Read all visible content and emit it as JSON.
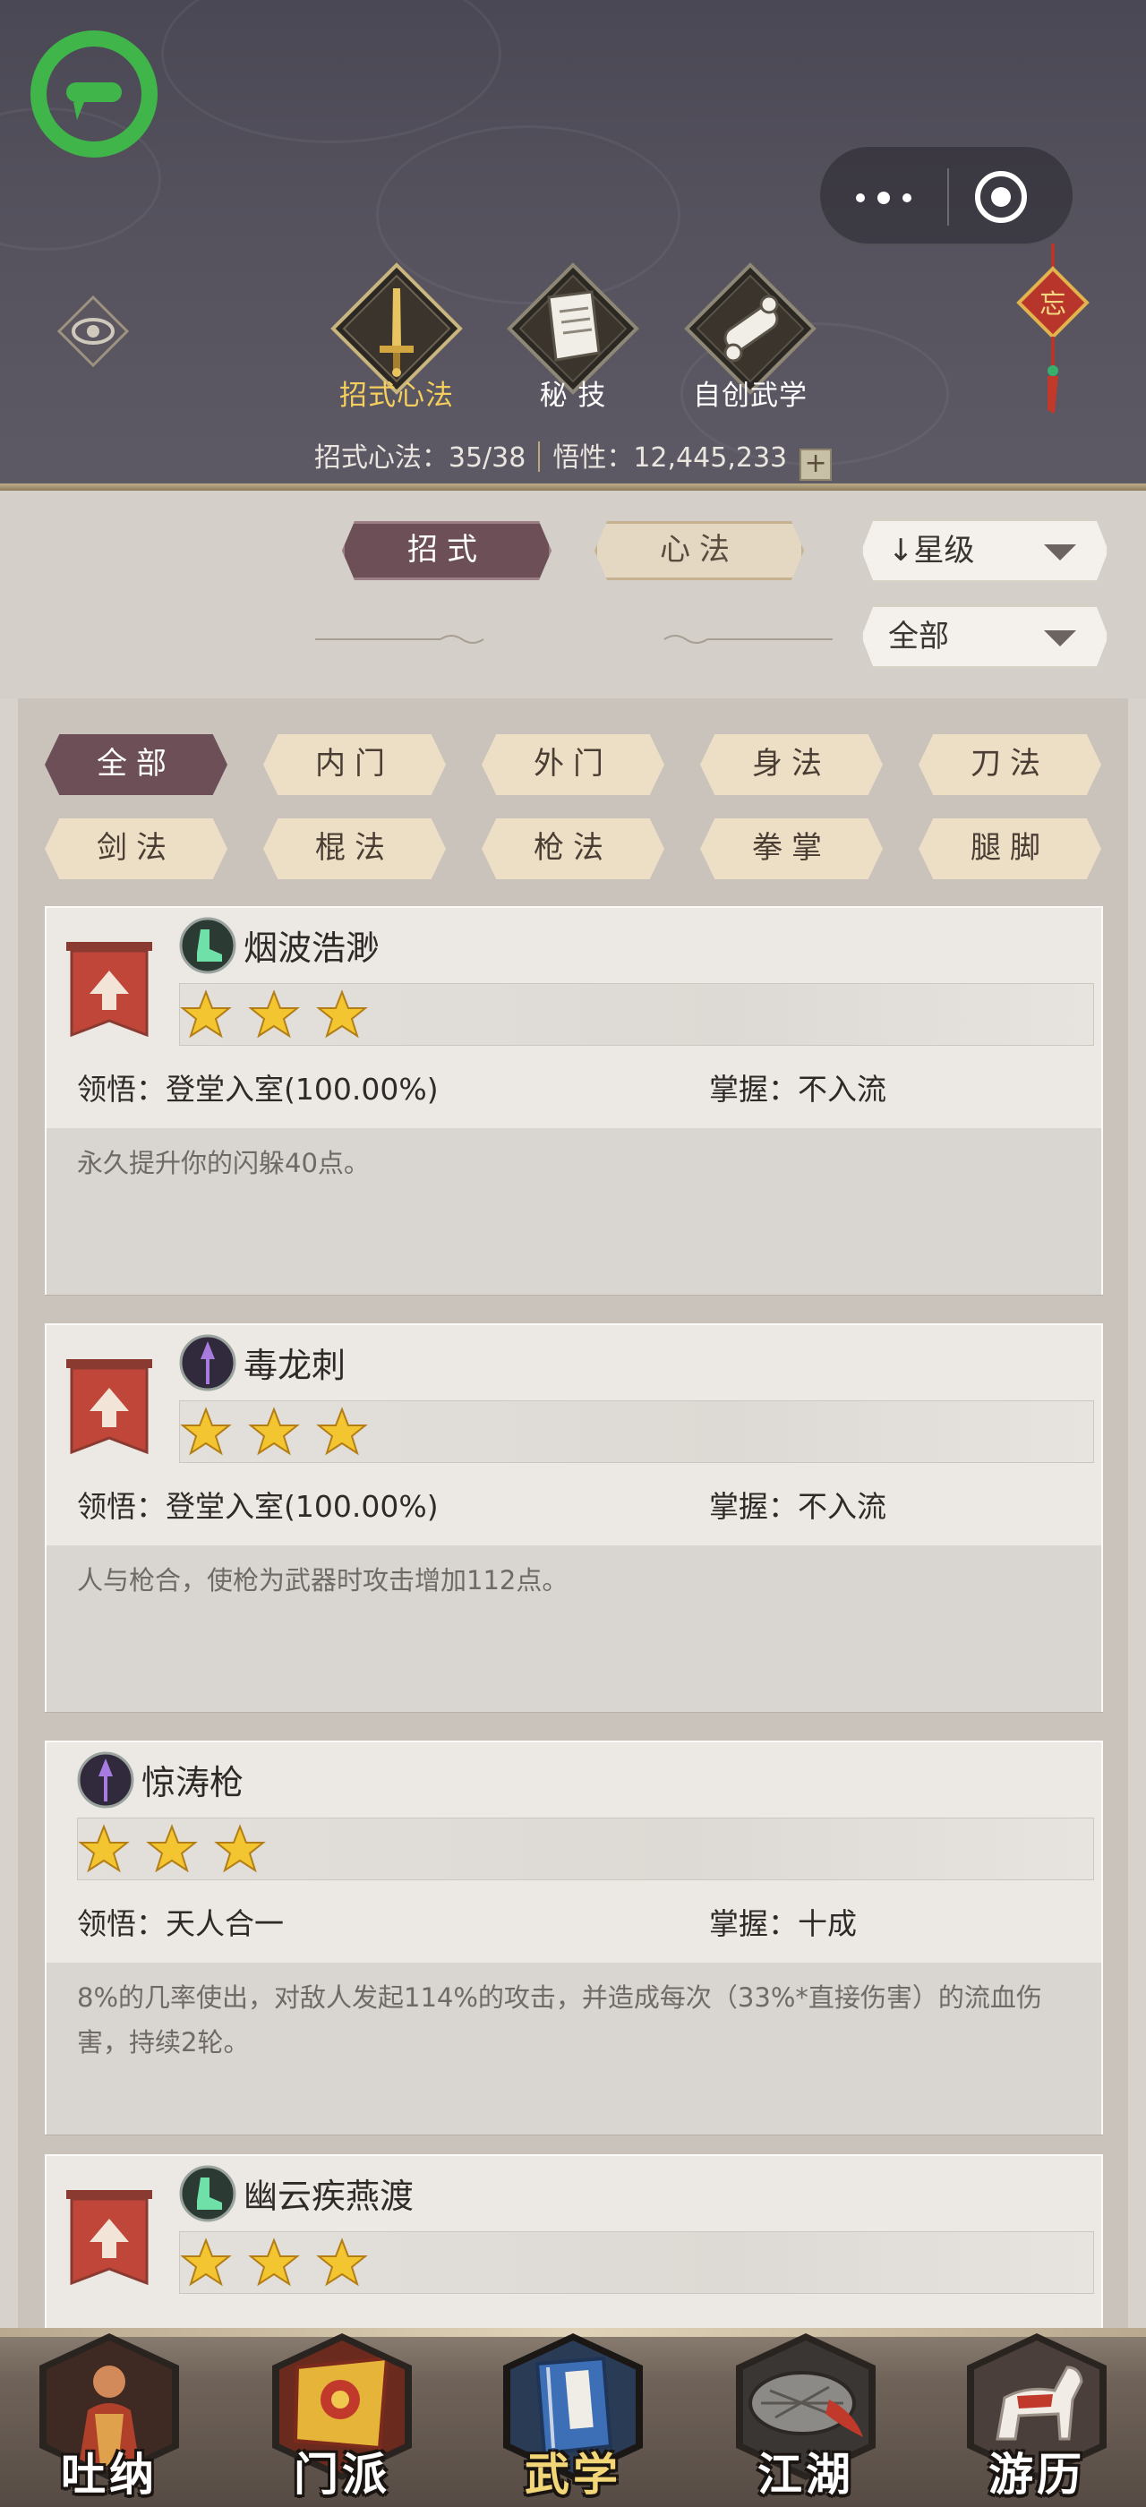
{
  "top_tabs": [
    {
      "label": "招式心法",
      "icon": "sword-icon"
    },
    {
      "label": "秘 技",
      "icon": "book-icon"
    },
    {
      "label": "自创武学",
      "icon": "scroll-icon"
    }
  ],
  "stats": {
    "moves_label": "招式心法：",
    "moves_value": "35/38",
    "insight_label": "悟性：",
    "insight_value": "12,445,233",
    "plus": "+"
  },
  "charm_char": "忘",
  "mode_tabs": [
    {
      "label": "招式",
      "active": true
    },
    {
      "label": "心法",
      "active": false
    }
  ],
  "sort_dropdown": {
    "arrow": "↓",
    "value": "星级"
  },
  "filter_dropdown": {
    "value": "全部"
  },
  "categories": [
    {
      "label": "全部",
      "active": true
    },
    {
      "label": "内门",
      "active": false
    },
    {
      "label": "外门",
      "active": false
    },
    {
      "label": "身法",
      "active": false
    },
    {
      "label": "刀法",
      "active": false
    },
    {
      "label": "剑法",
      "active": false
    },
    {
      "label": "棍法",
      "active": false
    },
    {
      "label": "枪法",
      "active": false
    },
    {
      "label": "拳掌",
      "active": false
    },
    {
      "label": "腿脚",
      "active": false
    }
  ],
  "skills": [
    {
      "name": "烟波浩渺",
      "type_icon": "boot-icon",
      "stars": 3,
      "upgradable": true,
      "lingwu_label": "领悟：",
      "lingwu": "登堂入室(100.00%)",
      "zhangwo_label": "掌握：",
      "zhangwo": "不入流",
      "desc": "永久提升你的闪躲40点。"
    },
    {
      "name": "毒龙刺",
      "type_icon": "spear-icon",
      "stars": 3,
      "upgradable": true,
      "lingwu_label": "领悟：",
      "lingwu": "登堂入室(100.00%)",
      "zhangwo_label": "掌握：",
      "zhangwo": "不入流",
      "desc": "人与枪合，使枪为武器时攻击增加112点。"
    },
    {
      "name": "惊涛枪",
      "type_icon": "spear-icon",
      "stars": 3,
      "upgradable": false,
      "lingwu_label": "领悟：",
      "lingwu": "天人合一",
      "zhangwo_label": "掌握：",
      "zhangwo": "十成",
      "desc": "8%的几率使出，对敌人发起114%的攻击，并造成每次（33%*直接伤害）的流血伤害，持续2轮。"
    },
    {
      "name": "幽云疾燕渡",
      "type_icon": "boot-icon",
      "stars": 3,
      "upgradable": true
    }
  ],
  "bottom_nav": [
    {
      "label": "吐纳",
      "icon": "monk-icon",
      "active": false
    },
    {
      "label": "门派",
      "icon": "sect-banner-icon",
      "active": false
    },
    {
      "label": "武学",
      "icon": "manual-book-icon",
      "active": true
    },
    {
      "label": "江湖",
      "icon": "straw-hat-icon",
      "active": false
    },
    {
      "label": "游历",
      "icon": "horse-icon",
      "active": false
    }
  ],
  "colors": {
    "header_bg": "#55525e",
    "active_tab_text": "#f4cf5b",
    "pill_active": "#6d4f57",
    "pill_inactive": "#e4d8c2",
    "star": "#f2c531",
    "banner_red": "#c0463a",
    "logo_green": "#3fb54a"
  }
}
